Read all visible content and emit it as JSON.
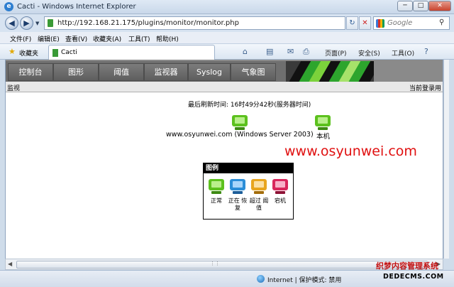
{
  "window": {
    "title": "Cacti - Windows Internet Explorer",
    "minimize": "─",
    "maximize": "□",
    "close": "✕"
  },
  "address": {
    "url": "http://192.168.21.175/plugins/monitor/monitor.php",
    "search_placeholder": "Google"
  },
  "menu": [
    "文件(F)",
    "编辑(E)",
    "查看(V)",
    "收藏夹(A)",
    "工具(T)",
    "帮助(H)"
  ],
  "favorites": {
    "label": "收藏夹",
    "tab_label": "Cacti",
    "commands": [
      "页面(P)",
      "安全(S)",
      "工具(O)"
    ]
  },
  "cacti": {
    "tabs": [
      "控制台",
      "图形",
      "阈值",
      "监视器",
      "Syslog",
      "气象图"
    ],
    "breadcrumb_left": "监视",
    "breadcrumb_right": "当前登录用",
    "refresh_text": "最后刷新时间: 16时49分42秒(服务器时间)",
    "hosts": [
      {
        "label": "www.osyunwei.com (Windows Server 2003)",
        "status_color": "#5cc11e"
      },
      {
        "label": "本机",
        "status_color": "#5cc11e"
      }
    ],
    "legend": {
      "title": "图例",
      "items": [
        {
          "label": "正常",
          "color": "#5cc11e"
        },
        {
          "label": "正在 恢复",
          "color": "#2b8ed8"
        },
        {
          "label": "超过 阈值",
          "color": "#e8a51f"
        },
        {
          "label": "宕机",
          "color": "#d8265c"
        }
      ]
    }
  },
  "overlay": {
    "watermark": "www.osyunwei.com",
    "footer_top": "织梦内容管理系统",
    "footer_bottom": "DEDECMS.COM"
  },
  "status": {
    "zone": "Internet | 保护模式: 禁用"
  }
}
